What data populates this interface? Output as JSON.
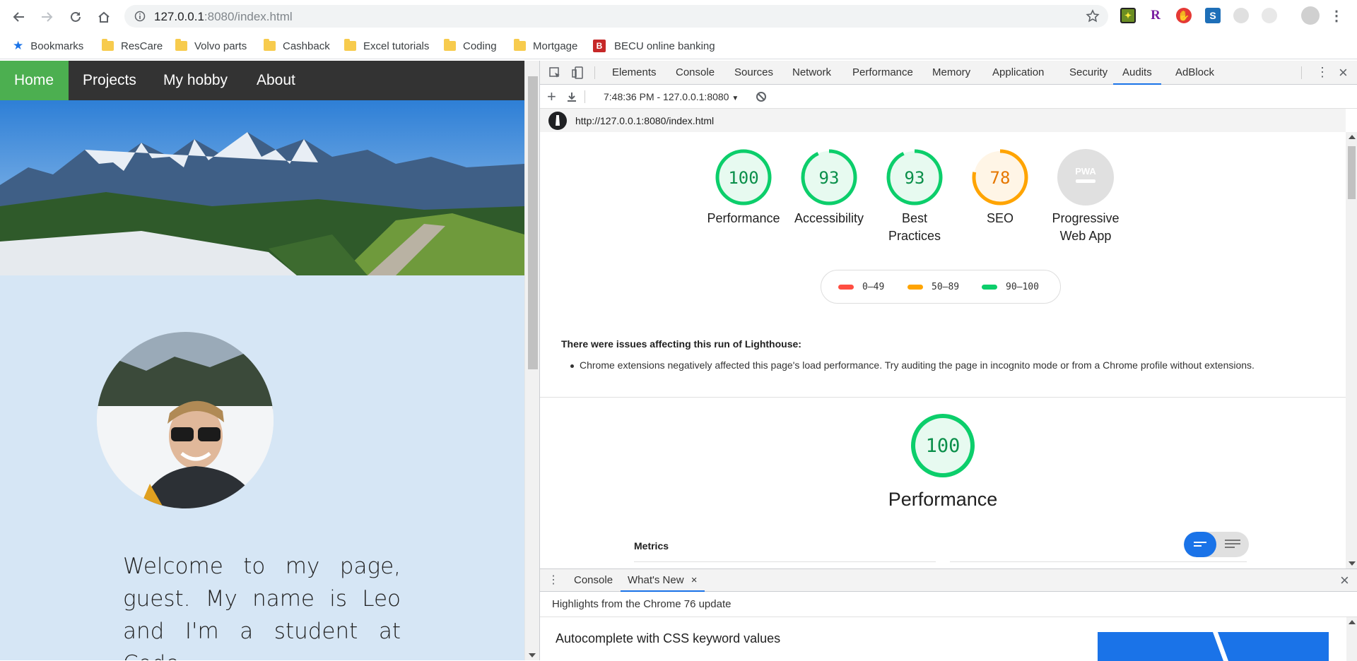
{
  "browser": {
    "url_host": "127.0.0.1",
    "url_rest": ":8080/index.html",
    "bookmarks": [
      {
        "label": "Bookmarks",
        "icon": "star-icon"
      },
      {
        "label": "ResCare",
        "icon": "folder-icon"
      },
      {
        "label": "Volvo parts",
        "icon": "folder-icon"
      },
      {
        "label": "Cashback",
        "icon": "folder-icon"
      },
      {
        "label": "Excel tutorials",
        "icon": "folder-icon"
      },
      {
        "label": "Coding",
        "icon": "folder-icon"
      },
      {
        "label": "Mortgage",
        "icon": "folder-icon"
      },
      {
        "label": "BECU online banking",
        "icon": "becu-icon",
        "badge": "B"
      }
    ],
    "extension_badge": "R"
  },
  "site": {
    "nav": [
      "Home",
      "Projects",
      "My hobby",
      "About"
    ],
    "active_nav": "Home",
    "active_color": "#4caf50",
    "welcome": "Welcome to my page, guest. My name is Leo and I'm a student at Code"
  },
  "devtools": {
    "tabs": [
      "Elements",
      "Console",
      "Sources",
      "Network",
      "Performance",
      "Memory",
      "Application",
      "Security",
      "Audits",
      "AdBlock"
    ],
    "active_tab": "Audits",
    "audit_run": "7:48:36 PM - 127.0.0.1:8080",
    "report_url": "http://127.0.0.1:8080/index.html",
    "gauges": [
      {
        "score": "100",
        "label1": "Performance",
        "label2": "",
        "value": 100,
        "color": "#0cce6b",
        "fill": "#e7faf0"
      },
      {
        "score": "93",
        "label1": "Accessibility",
        "label2": "",
        "value": 93,
        "color": "#0cce6b",
        "fill": "#e7faf0"
      },
      {
        "score": "93",
        "label1": "Best",
        "label2": "Practices",
        "value": 93,
        "color": "#0cce6b",
        "fill": "#e7faf0"
      },
      {
        "score": "78",
        "label1": "SEO",
        "label2": "",
        "value": 78,
        "color": "#ffa400",
        "fill": "#fff5e6"
      },
      {
        "score": "PWA",
        "label1": "Progressive",
        "label2": "Web App",
        "value": 0,
        "color": "#e0e0e0",
        "fill": "#e0e0e0"
      }
    ],
    "legend": [
      {
        "label": "0–49",
        "color": "#ff4e42"
      },
      {
        "label": "50–89",
        "color": "#ffa400"
      },
      {
        "label": "90–100",
        "color": "#0cce6b"
      }
    ],
    "warning_title": "There were issues affecting this run of Lighthouse:",
    "warning_item": "Chrome extensions negatively affected this page's load performance. Try auditing the page in incognito mode or from a Chrome profile without extensions.",
    "perf_score": "100",
    "perf_title": "Performance",
    "metrics_label": "Metrics",
    "drawer_tabs": [
      "Console",
      "What's New"
    ],
    "drawer_active": "What's New",
    "highlights": "Highlights from the Chrome 76 update",
    "feature_title": "Autocomplete with CSS keyword values"
  }
}
